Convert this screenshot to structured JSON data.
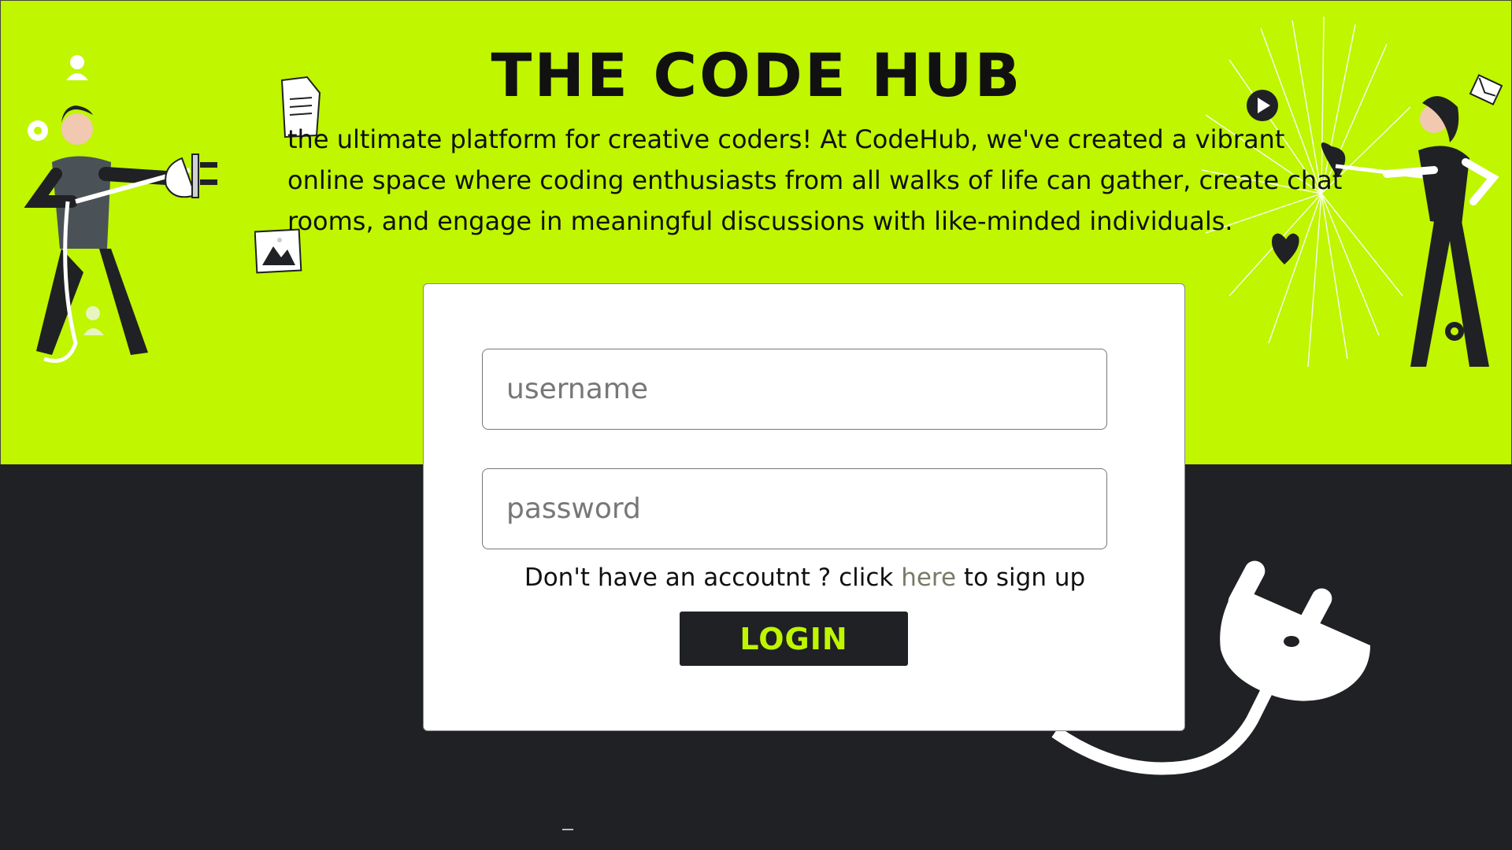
{
  "header": {
    "title": "THE CODE HUB",
    "intro": "the ultimate platform for creative coders! At CodeHub, we've created a vibrant online space where coding enthusiasts from all walks of life can gather, create chat rooms, and engage in meaningful discussions with like-minded individuals."
  },
  "login_form": {
    "username_placeholder": "username",
    "password_placeholder": "password",
    "signup_prefix": "Don't have an accoutnt ? click ",
    "signup_link": "here",
    "signup_suffix": " to sign up",
    "login_label": "LOGIN"
  },
  "colors": {
    "accent": "#bff600",
    "dark": "#202124",
    "card": "#ffffff"
  },
  "icons": [
    "person-icon",
    "gear-icon",
    "document-icon",
    "image-icon",
    "play-icon",
    "envelope-icon",
    "heart-icon",
    "plug-icon"
  ]
}
